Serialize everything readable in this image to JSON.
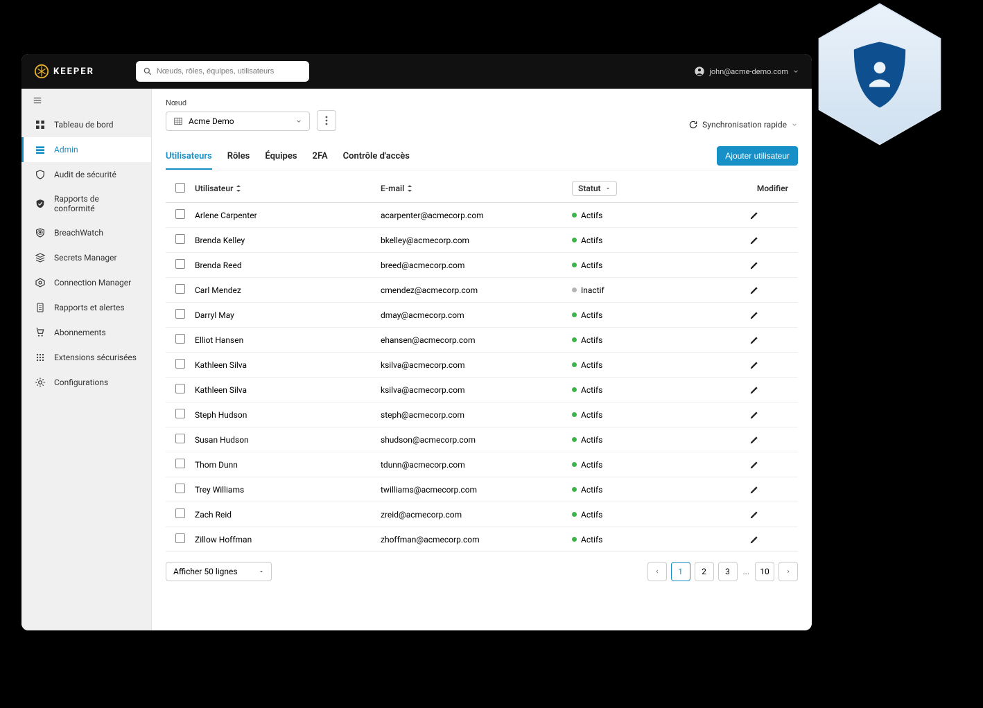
{
  "brand": {
    "name": "KEEPER"
  },
  "search": {
    "placeholder": "Nœuds, rôles, équipes, utilisateurs"
  },
  "account": {
    "email": "john@acme-demo.com"
  },
  "sidebar": {
    "items": [
      {
        "label": "Tableau de bord"
      },
      {
        "label": "Admin"
      },
      {
        "label": "Audit de sécurité"
      },
      {
        "label": "Rapports de conformité"
      },
      {
        "label": "BreachWatch"
      },
      {
        "label": "Secrets Manager"
      },
      {
        "label": "Connection Manager"
      },
      {
        "label": "Rapports et alertes"
      },
      {
        "label": "Abonnements"
      },
      {
        "label": "Extensions sécurisées"
      },
      {
        "label": "Configurations"
      }
    ]
  },
  "node": {
    "label": "Nœud",
    "value": "Acme Demo"
  },
  "sync": {
    "label": "Synchronisation rapide"
  },
  "tabs": [
    {
      "label": "Utilisateurs"
    },
    {
      "label": "Rôles"
    },
    {
      "label": "Équipes"
    },
    {
      "label": "2FA"
    },
    {
      "label": "Contrôle d'accès"
    }
  ],
  "buttons": {
    "add_user": "Ajouter utilisateur"
  },
  "columns": {
    "user": "Utilisateur",
    "email": "E-mail",
    "status": "Statut",
    "edit": "Modifier"
  },
  "status_labels": {
    "active": "Actifs",
    "inactive": "Inactif"
  },
  "users": [
    {
      "name": "Arlene Carpenter",
      "email": "acarpenter@acmecorp.com",
      "status": "active"
    },
    {
      "name": "Brenda Kelley",
      "email": "bkelley@acmecorp.com",
      "status": "active"
    },
    {
      "name": "Brenda Reed",
      "email": "breed@acmecorp.com",
      "status": "active"
    },
    {
      "name": "Carl Mendez",
      "email": "cmendez@acmecorp.com",
      "status": "inactive"
    },
    {
      "name": "Darryl May",
      "email": "dmay@acmecorp.com",
      "status": "active"
    },
    {
      "name": "Elliot Hansen",
      "email": "ehansen@acmecorp.com",
      "status": "active"
    },
    {
      "name": "Kathleen Silva",
      "email": "ksilva@acmecorp.com",
      "status": "active"
    },
    {
      "name": "Kathleen Silva",
      "email": "ksilva@acmecorp.com",
      "status": "active"
    },
    {
      "name": "Steph Hudson",
      "email": "steph@acmecorp.com",
      "status": "active"
    },
    {
      "name": "Susan Hudson",
      "email": "shudson@acmecorp.com",
      "status": "active"
    },
    {
      "name": "Thom Dunn",
      "email": "tdunn@acmecorp.com",
      "status": "active"
    },
    {
      "name": "Trey Williams",
      "email": "twilliams@acmecorp.com",
      "status": "active"
    },
    {
      "name": "Zach Reid",
      "email": "zreid@acmecorp.com",
      "status": "active"
    },
    {
      "name": "Zillow Hoffman",
      "email": "zhoffman@acmecorp.com",
      "status": "active"
    }
  ],
  "pagination": {
    "rows_label": "Afficher 50 lignes",
    "pages": [
      "1",
      "2",
      "3"
    ],
    "last": "10",
    "ellipsis": "..."
  }
}
